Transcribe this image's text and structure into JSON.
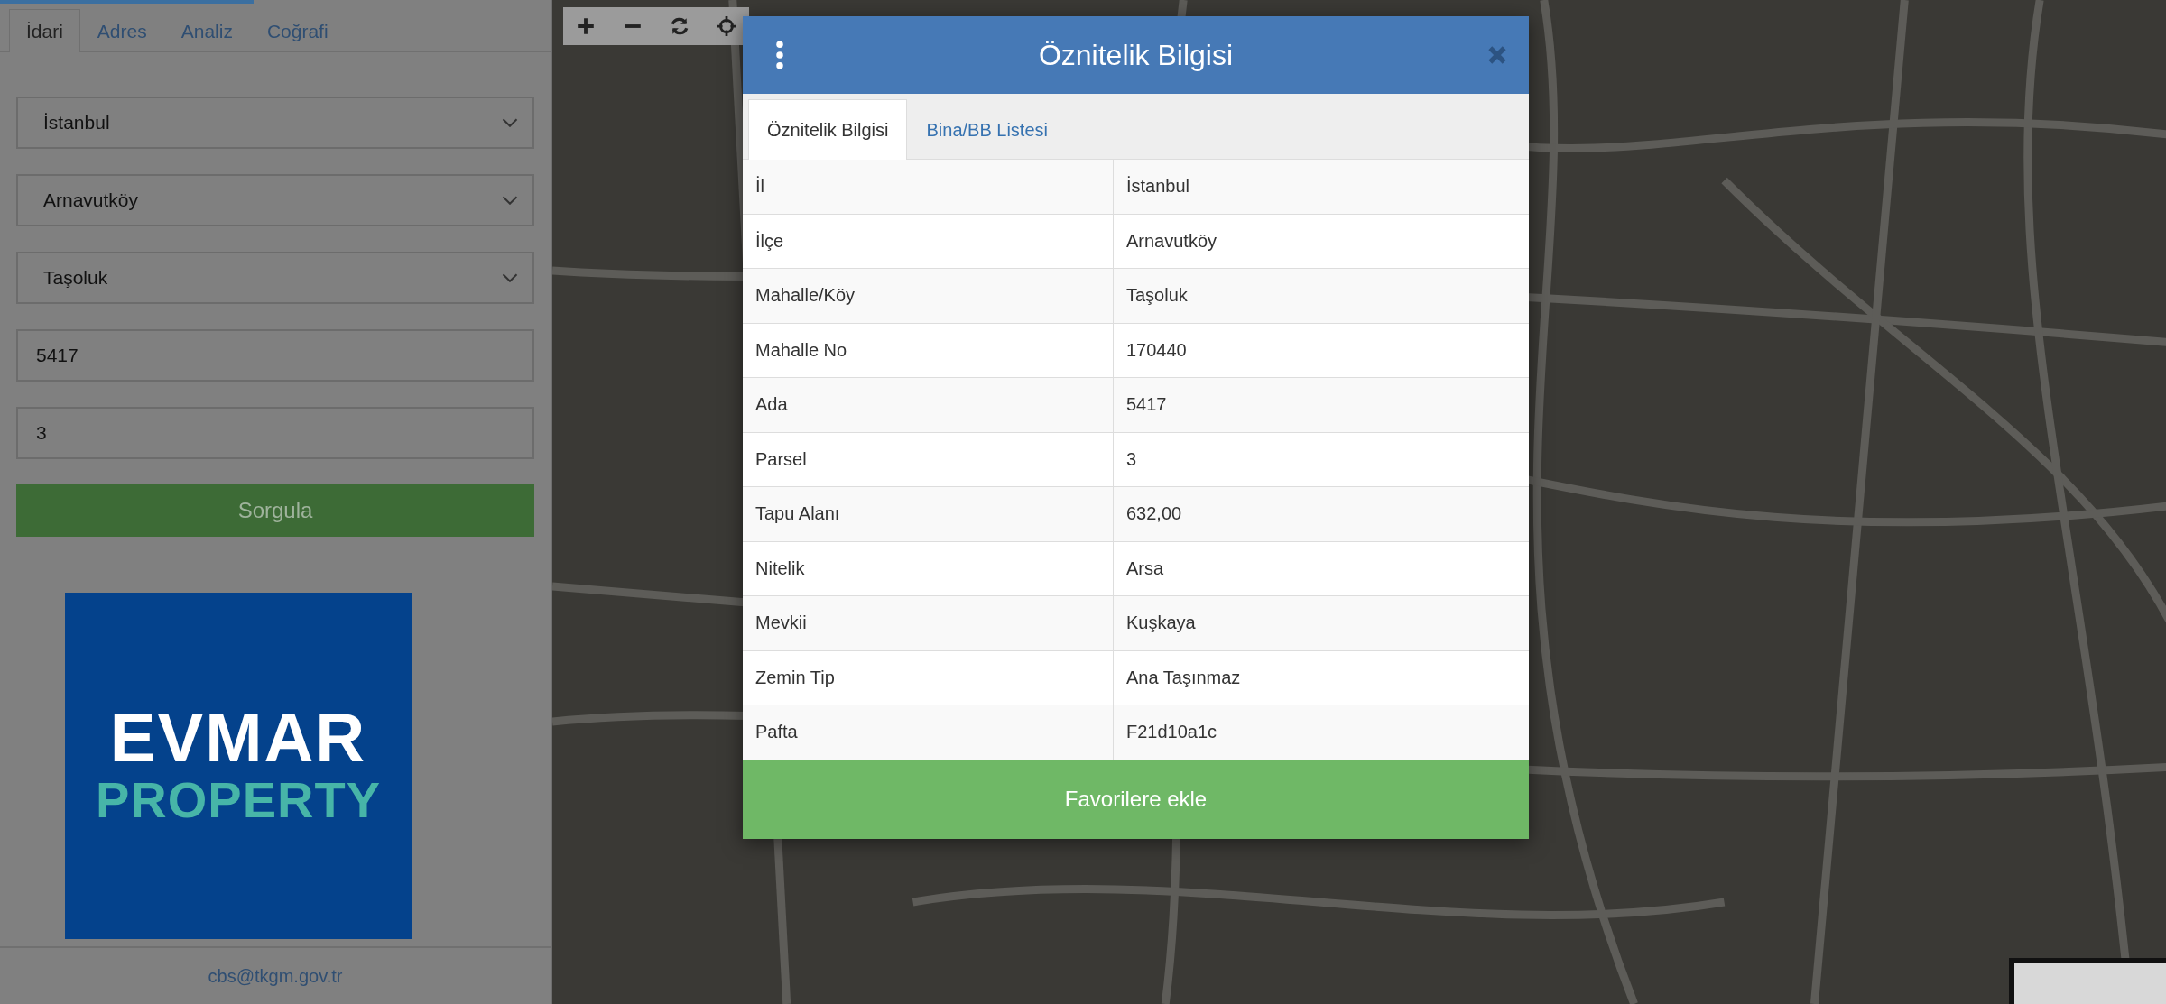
{
  "sidebar": {
    "progress": {
      "level": 0.46
    },
    "tabs": [
      {
        "label": "İdari",
        "selected": true
      },
      {
        "label": "Adres",
        "selected": false
      },
      {
        "label": "Analiz",
        "selected": false
      },
      {
        "label": "Coğrafi",
        "selected": false
      }
    ],
    "fields": [
      {
        "kind": "select",
        "value": "İstanbul"
      },
      {
        "kind": "select",
        "value": "Arnavutköy"
      },
      {
        "kind": "select",
        "value": "Taşoluk"
      },
      {
        "kind": "input",
        "value": "5417"
      },
      {
        "kind": "input",
        "value": "3"
      }
    ],
    "query_button": "Sorgula",
    "logo": {
      "line_1": "EVMAR",
      "line_2": "PROPERTY"
    },
    "footer_email": "cbs@tkgm.gov.tr"
  },
  "map_toolbar": [
    {
      "kind": "plus"
    },
    {
      "kind": "minus"
    },
    {
      "kind": "refresh"
    },
    {
      "kind": "locate"
    }
  ],
  "dialog": {
    "title": "Öznitelik Bilgisi",
    "tabs": [
      {
        "label": "Öznitelik Bilgisi",
        "selected": true
      },
      {
        "label": "Bina/BB Listesi",
        "selected": false
      }
    ],
    "rows": [
      {
        "label": "İl",
        "value": "İstanbul"
      },
      {
        "label": "İlçe",
        "value": "Arnavutköy"
      },
      {
        "label": "Mahalle/Köy",
        "value": "Taşoluk"
      },
      {
        "label": "Mahalle No",
        "value": "170440"
      },
      {
        "label": "Ada",
        "value": "5417"
      },
      {
        "label": "Parsel",
        "value": "3"
      },
      {
        "label": "Tapu Alanı",
        "value": "632,00"
      },
      {
        "label": "Nitelik",
        "value": "Arsa"
      },
      {
        "label": "Mevkii",
        "value": "Kuşkaya"
      },
      {
        "label": "Zemin Tip",
        "value": "Ana Taşınmaz"
      },
      {
        "label": "Pafta",
        "value": "F21d10a1c"
      }
    ],
    "action_button": "Favorilere ekle"
  }
}
